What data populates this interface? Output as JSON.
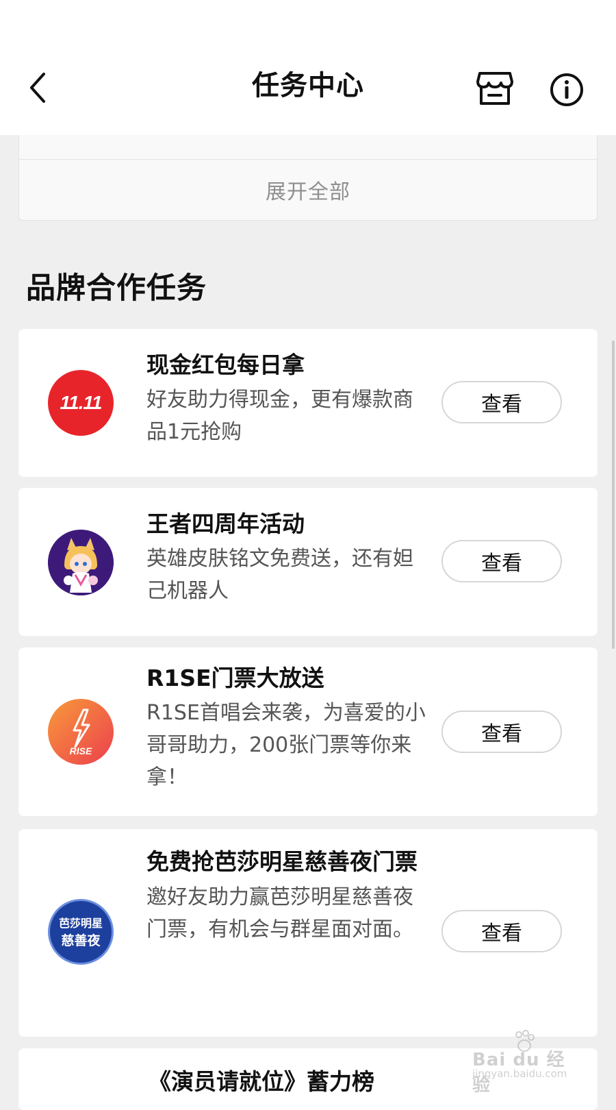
{
  "header": {
    "title": "任务中心"
  },
  "expand": {
    "label": "展开全部"
  },
  "section": {
    "title": "品牌合作任务"
  },
  "tasks": [
    {
      "title": "现金红包每日拿",
      "desc": "好友助力得现金，更有爆款商品1元抢购",
      "button": "查看",
      "logo_text": "11.11",
      "logo_color": "#e8242b"
    },
    {
      "title": "王者四周年活动",
      "desc": "英雄皮肤铭文免费送，还有妲己机器人",
      "button": "查看",
      "logo_color": "#3d1a7a"
    },
    {
      "title": "R1SE门票大放送",
      "desc": "R1SE首唱会来袭，为喜爱的小哥哥助力，200张门票等你来拿！",
      "button": "查看",
      "logo_text": "RISE",
      "logo_color": "#f25a3a"
    },
    {
      "title": "免费抢芭莎明星慈善夜门票",
      "desc": "邀好友助力赢芭莎明星慈善夜门票，有机会与群星面对面。",
      "button": "查看",
      "logo_text_line1": "芭莎明星",
      "logo_text_line2": "慈善夜",
      "logo_color": "#1d3f9e"
    },
    {
      "title": "《演员请就位》蓄力榜"
    }
  ],
  "watermark": {
    "brand": "Bai du 经验",
    "url": "jingyan.baidu.com"
  }
}
